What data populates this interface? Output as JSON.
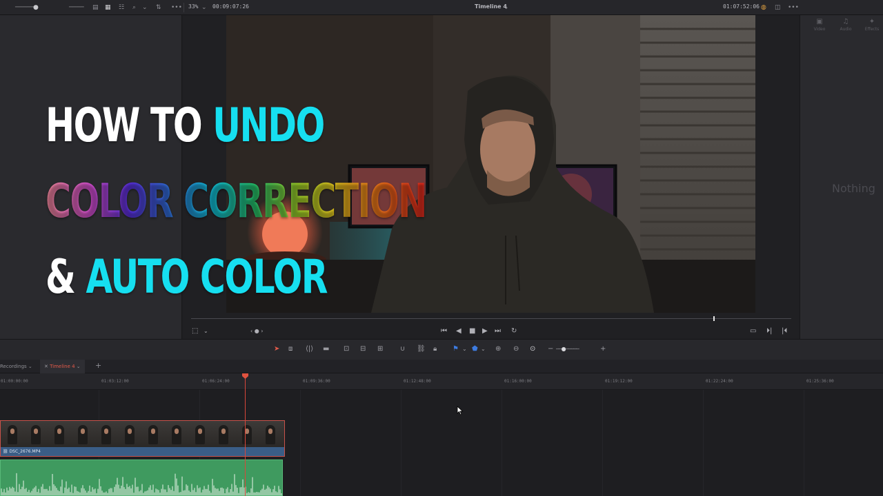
{
  "topbar": {
    "zoom": "33%",
    "source_timecode": "00:09:07:26",
    "timeline_name": "Timeline 4",
    "record_timecode": "01:07:52:06"
  },
  "right_panel": {
    "tabs": [
      {
        "label": "Video",
        "icon": "film-icon"
      },
      {
        "label": "Audio",
        "icon": "music-note-icon"
      },
      {
        "label": "Effects",
        "icon": "magic-wand-icon"
      }
    ],
    "empty_text": "Nothing"
  },
  "timeline_tabs": {
    "recordings": "Recordings",
    "timeline": "Timeline 4"
  },
  "ruler": {
    "labels": [
      "01:00:00:00",
      "01:03:12:00",
      "01:06:24:00",
      "01:09:36:00",
      "01:12:48:00",
      "01:16:00:00",
      "01:19:12:00",
      "01:22:24:00",
      "01:25:36:00"
    ]
  },
  "clip": {
    "name": "DSC_2676.MP4"
  },
  "overlay": {
    "line1_white": "HOW TO ",
    "line1_cyan": "UNDO",
    "line2": "COLOR CORRECTION",
    "line3_white": "& ",
    "line3_cyan": "AUTO COLOR"
  },
  "colors": {
    "accent_red": "#d9463a",
    "overlay_cyan": "#16dff0",
    "video_track": "#3a5d86",
    "audio_track": "#3f9a5f"
  },
  "playback": {
    "scrubber_position": 0.87
  }
}
